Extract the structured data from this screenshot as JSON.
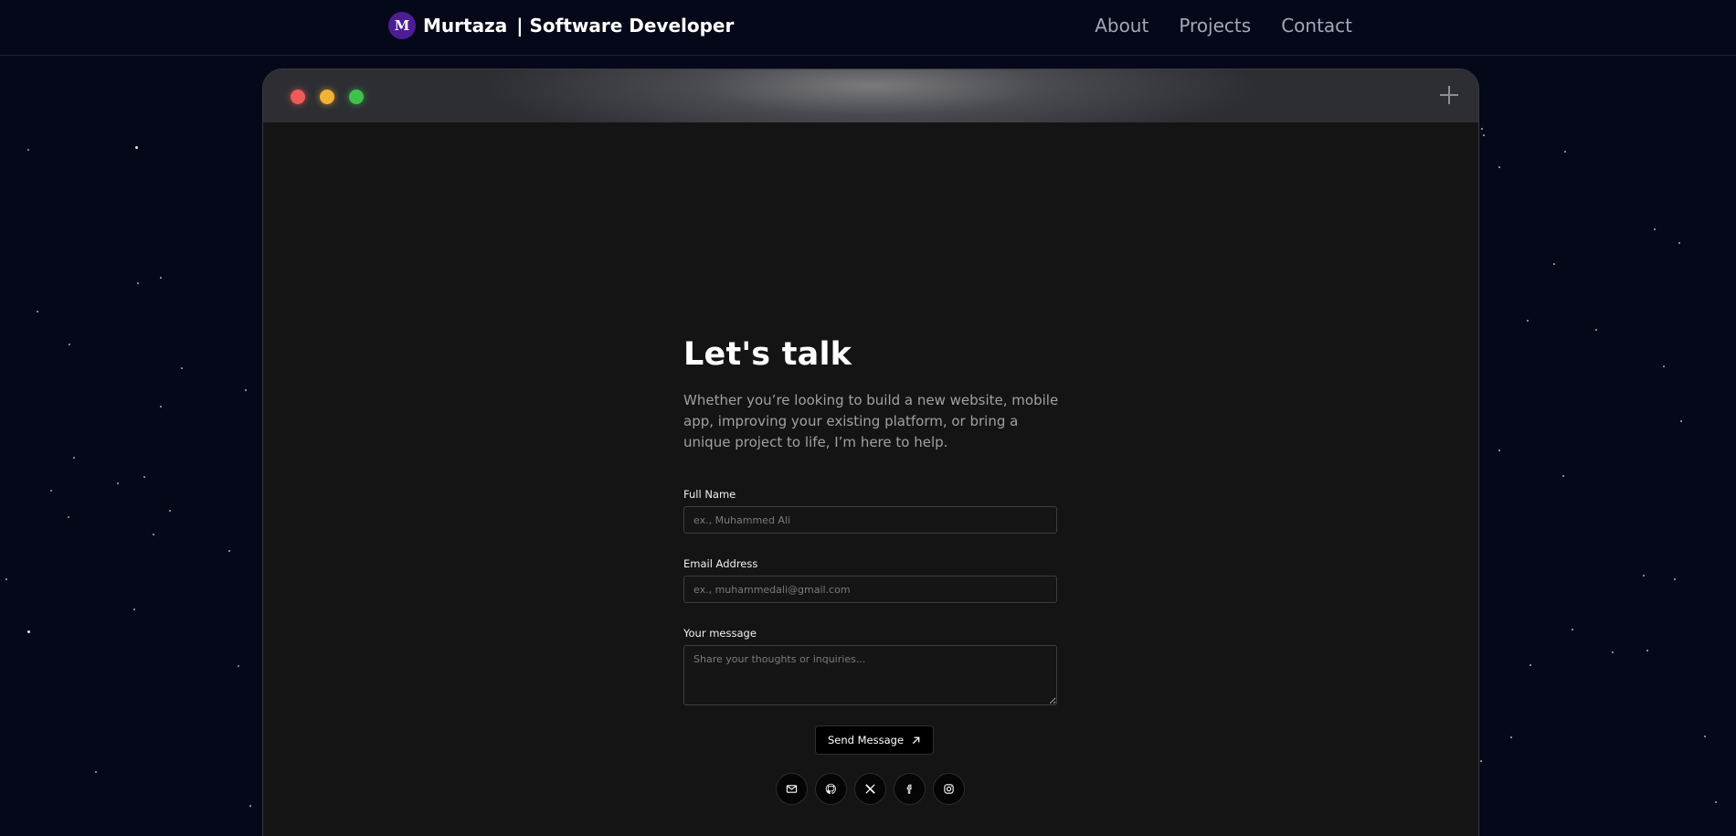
{
  "nav": {
    "logo_letter": "M",
    "brand_name": "Murtaza",
    "brand_tagline": "| Software Developer",
    "links": [
      "About",
      "Projects",
      "Contact"
    ]
  },
  "browser": {
    "window_controls": [
      "close",
      "minimize",
      "maximize"
    ],
    "new_tab_icon": "plus-icon"
  },
  "contact": {
    "title": "Let's talk",
    "subtitle": "Whether you’re looking to build a new website, mobile app, improving your existing platform, or bring a unique project to life, I’m here to help.",
    "name_label": "Full Name",
    "name_placeholder": "ex., Muhammed Ali",
    "email_label": "Email Address",
    "email_placeholder": "ex., muhammedali@gmail.com",
    "message_label": "Your message",
    "message_placeholder": "Share your thoughts or inquiries...",
    "send_label": "Send Message",
    "socials": [
      "mail-icon",
      "github-icon",
      "x-icon",
      "facebook-icon",
      "instagram-icon"
    ]
  },
  "colors": {
    "background": "#050818",
    "logo_bg": "#4c1d95",
    "panel": "#141414",
    "dot_red": "#ef5a57",
    "dot_yellow": "#f2b233",
    "dot_green": "#3fc24b"
  }
}
